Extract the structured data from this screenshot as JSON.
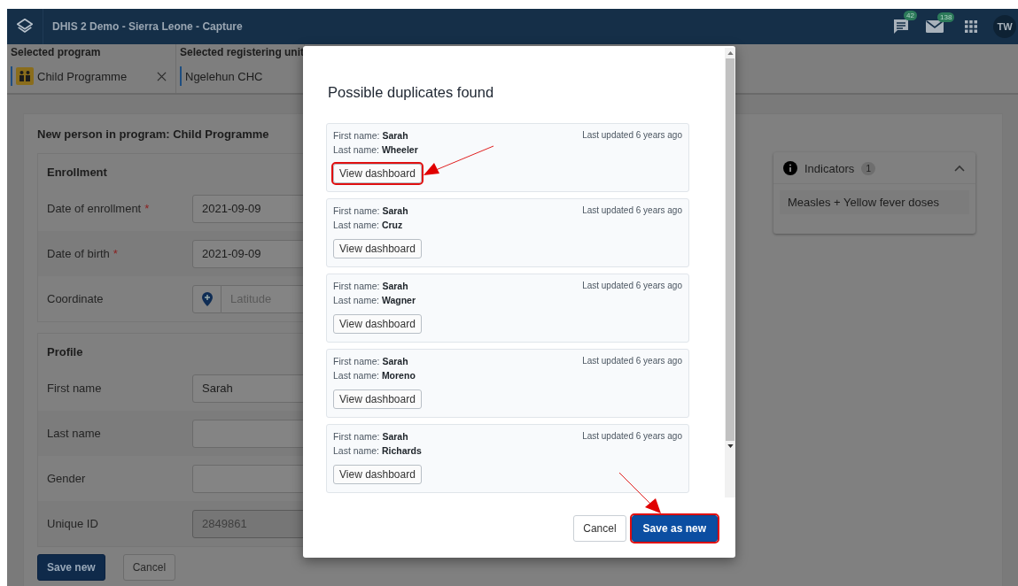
{
  "header": {
    "title": "DHIS 2 Demo - Sierra Leone - Capture",
    "messages_badge": "42",
    "mail_badge": "138",
    "avatar": "TW"
  },
  "context": [
    {
      "label": "Selected program",
      "value": "Child Programme",
      "clearable": true,
      "has_icon": true
    },
    {
      "label": "Selected registering unit",
      "value": "Ngelehun CHC",
      "clearable": false,
      "has_icon": false
    }
  ],
  "form": {
    "title": "New person in program: Child Programme",
    "sections": [
      {
        "title": "Enrollment",
        "fields": [
          {
            "kind": "text",
            "label": "Date of enrollment",
            "required_mark": "*",
            "value": "2021-09-09",
            "disabled": false
          },
          {
            "kind": "text",
            "label": "Date of birth",
            "required_mark": "*",
            "value": "2021-09-09",
            "disabled": false
          },
          {
            "kind": "coordinate",
            "label": "Coordinate",
            "placeholder": "Latitude",
            "disabled": false
          }
        ]
      },
      {
        "title": "Profile",
        "fields": [
          {
            "kind": "text",
            "label": "First name",
            "value": "Sarah",
            "disabled": false
          },
          {
            "kind": "text",
            "label": "Last name",
            "disabled": false
          },
          {
            "kind": "text",
            "label": "Gender",
            "disabled": false
          },
          {
            "kind": "text",
            "label": "Unique ID",
            "value": "2849861",
            "disabled": true
          }
        ]
      }
    ],
    "buttons": [
      {
        "label": "Save new",
        "primary": true
      },
      {
        "label": "Cancel",
        "primary": false
      }
    ]
  },
  "indicators": {
    "title": "Indicators",
    "count": "1",
    "expanded": true,
    "items": [
      "Measles + Yellow fever doses"
    ]
  },
  "dialog": {
    "title": "Possible duplicates found",
    "duplicates": [
      {
        "first": "First name: **Sarah**",
        "last": "Last name: **Wheeler**",
        "updated": "Last updated 6 years ago",
        "button": "View dashboard",
        "highlighted": true
      },
      {
        "first": "First name: **Sarah**",
        "last": "Last name: **Cruz**",
        "updated": "Last updated 6 years ago",
        "button": "View dashboard",
        "highlighted": false
      },
      {
        "first": "First name: **Sarah**",
        "last": "Last name: **Wagner**",
        "updated": "Last updated 6 years ago",
        "button": "View dashboard",
        "highlighted": false
      },
      {
        "first": "First name: **Sarah**",
        "last": "Last name: **Moreno**",
        "updated": "Last updated 6 years ago",
        "button": "View dashboard",
        "highlighted": false
      },
      {
        "first": "First name: **Sarah**",
        "last": "Last name: **Richards**",
        "updated": "Last updated 6 years ago",
        "button": "View dashboard",
        "highlighted": false
      }
    ],
    "buttons": [
      {
        "label": "Cancel",
        "primary": false,
        "highlighted": false
      },
      {
        "label": "Save as new",
        "primary": true,
        "highlighted": true
      }
    ]
  }
}
